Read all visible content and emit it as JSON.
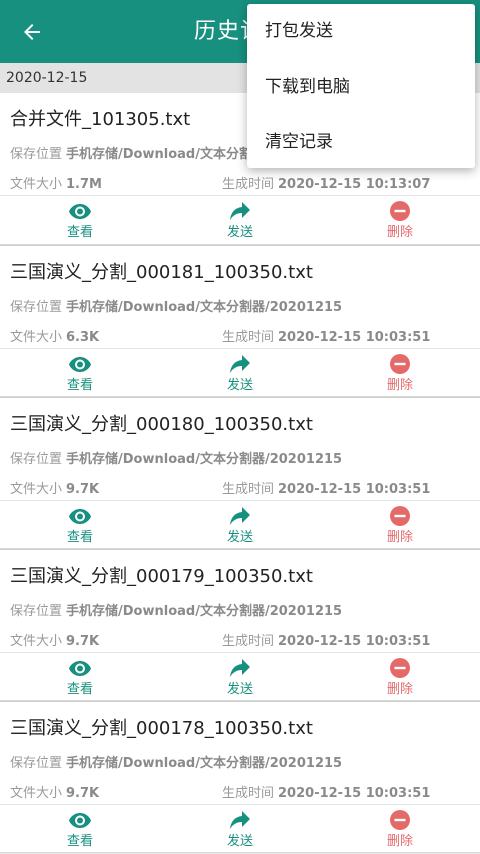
{
  "appbar": {
    "title": "历史记录",
    "back_icon": "arrow-left-icon"
  },
  "colors": {
    "primary": "#18907f",
    "delete": "#e46a6a"
  },
  "date_header": "2020-12-15",
  "labels": {
    "path_label": "保存位置",
    "size_label": "文件大小",
    "time_label": "生成时间",
    "view": "查看",
    "send": "发送",
    "delete": "删除"
  },
  "files": [
    {
      "name": "合并文件_101305.txt",
      "path": "手机存储/Download/文本分割器",
      "size": "1.7M",
      "time": "2020-12-15 10:13:07"
    },
    {
      "name": "三国演义_分割_000181_100350.txt",
      "path": "手机存储/Download/文本分割器/20201215",
      "size": "6.3K",
      "time": "2020-12-15 10:03:51"
    },
    {
      "name": "三国演义_分割_000180_100350.txt",
      "path": "手机存储/Download/文本分割器/20201215",
      "size": "9.7K",
      "time": "2020-12-15 10:03:51"
    },
    {
      "name": "三国演义_分割_000179_100350.txt",
      "path": "手机存储/Download/文本分割器/20201215",
      "size": "9.7K",
      "time": "2020-12-15 10:03:51"
    },
    {
      "name": "三国演义_分割_000178_100350.txt",
      "path": "手机存储/Download/文本分割器/20201215",
      "size": "9.7K",
      "time": "2020-12-15 10:03:51"
    }
  ],
  "menu": {
    "items": [
      "打包发送",
      "下载到电脑",
      "清空记录"
    ]
  }
}
